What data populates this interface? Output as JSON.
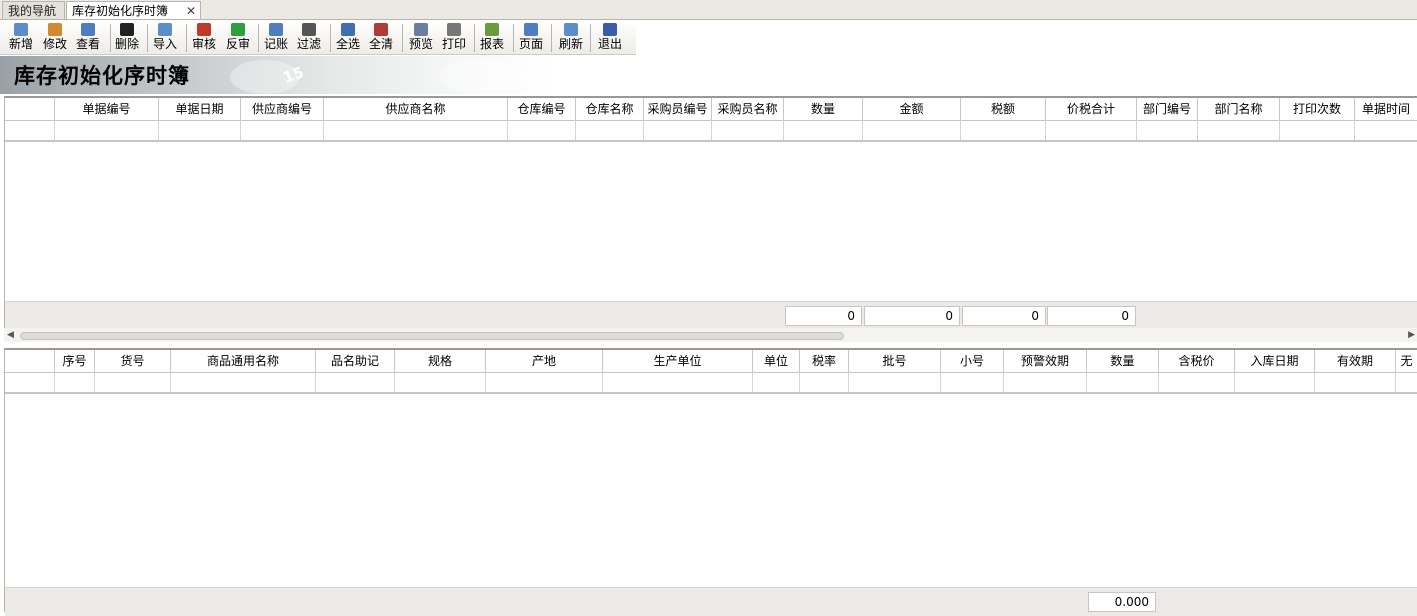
{
  "tabs": [
    {
      "label": "我的导航"
    },
    {
      "label": "库存初始化序时簿"
    }
  ],
  "toolbar": [
    {
      "label": "新增",
      "icon": "new-doc-icon",
      "color": "#5b8ec9"
    },
    {
      "label": "修改",
      "icon": "edit-icon",
      "color": "#d28a2e"
    },
    {
      "label": "查看",
      "icon": "view-icon",
      "color": "#4f7ec0"
    },
    {
      "label": "删除",
      "icon": "delete-icon",
      "color": "#222222"
    },
    {
      "label": "导入",
      "icon": "import-icon",
      "color": "#5b8ec9"
    },
    {
      "label": "审核",
      "icon": "audit-icon",
      "color": "#c0392b"
    },
    {
      "label": "反审",
      "icon": "unaudit-icon",
      "color": "#2e9e3e"
    },
    {
      "label": "记账",
      "icon": "ledger-icon",
      "color": "#4f7ec0"
    },
    {
      "label": "过滤",
      "icon": "filter-icon",
      "color": "#555555"
    },
    {
      "label": "全选",
      "icon": "select-all-icon",
      "color": "#3f6fb0"
    },
    {
      "label": "全清",
      "icon": "clear-all-icon",
      "color": "#b03a3a"
    },
    {
      "label": "预览",
      "icon": "preview-icon",
      "color": "#6a7fa0"
    },
    {
      "label": "打印",
      "icon": "print-icon",
      "color": "#777777"
    },
    {
      "label": "报表",
      "icon": "report-icon",
      "color": "#6a9b3c"
    },
    {
      "label": "页面",
      "icon": "page-icon",
      "color": "#4f7ec0"
    },
    {
      "label": "刷新",
      "icon": "refresh-icon",
      "color": "#5b8ec9"
    },
    {
      "label": "退出",
      "icon": "exit-icon",
      "color": "#3a5da8"
    }
  ],
  "page_title": "库存初始化序时簿",
  "banner_number": "15",
  "master_grid": {
    "columns": [
      "",
      "单据编号",
      "单据日期",
      "供应商编号",
      "供应商名称",
      "仓库编号",
      "仓库名称",
      "采购员编号",
      "采购员名称",
      "数量",
      "金额",
      "税额",
      "价税合计",
      "部门编号",
      "部门名称",
      "打印次数",
      "单据时间"
    ],
    "totals": [
      "0",
      "0",
      "0",
      "0"
    ]
  },
  "detail_grid": {
    "columns": [
      "",
      "序号",
      "货号",
      "商品通用名称",
      "品名助记",
      "规格",
      "产地",
      "生产单位",
      "单位",
      "税率",
      "批号",
      "小号",
      "预警效期",
      "数量",
      "含税价",
      "入库日期",
      "有效期",
      "无"
    ],
    "totals": [
      "0.000"
    ]
  }
}
